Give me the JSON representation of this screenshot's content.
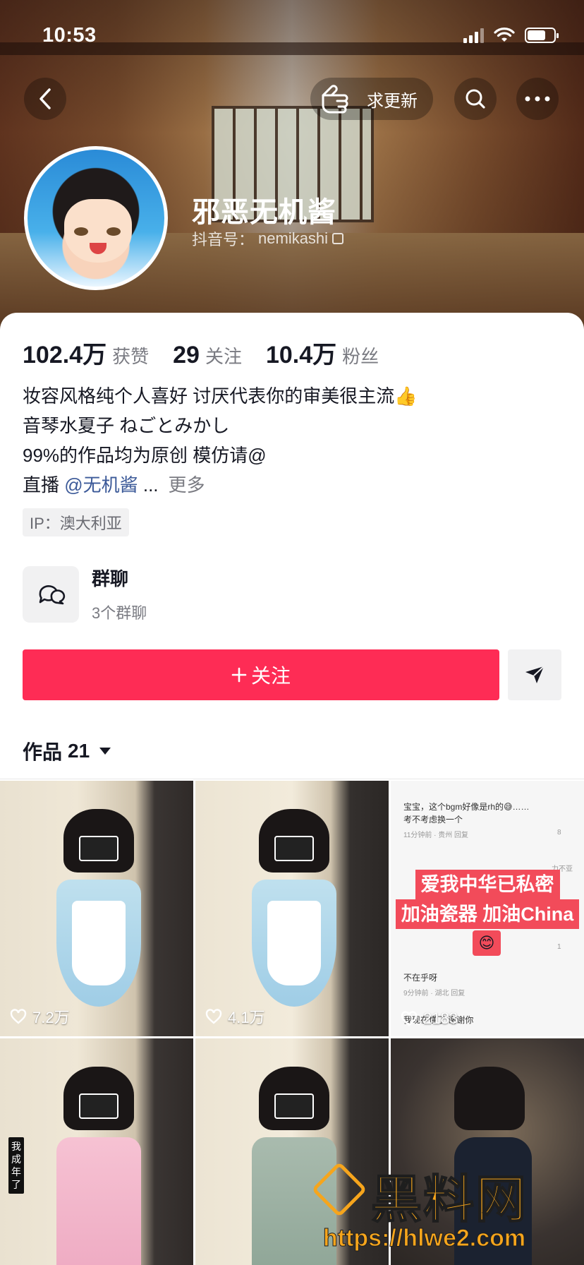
{
  "status_bar": {
    "time": "10:53"
  },
  "header": {
    "request_update": "求更新",
    "name": "邪恶无机酱",
    "uid_label": "抖音号：",
    "uid": "nemikashi"
  },
  "stats": [
    {
      "num": "102.4万",
      "label": "获赞"
    },
    {
      "num": "29",
      "label": "关注"
    },
    {
      "num": "10.4万",
      "label": "粉丝"
    }
  ],
  "bio": {
    "line1": "妆容风格纯个人喜好 讨厌代表你的审美很主流👍",
    "line2": "音琴水夏子 ねごとみかし",
    "line3": "99%的作品均为原创 模仿请@",
    "line4_prefix": "直播 ",
    "line4_mention": "@无机酱",
    "line4_ellipsis": " ...",
    "more": "更多"
  },
  "ip": "IP：澳大利亚",
  "group": {
    "title": "群聊",
    "subtitle": "3个群聊"
  },
  "actions": {
    "follow_label": "关注"
  },
  "works": {
    "label": "作品",
    "count": "21"
  },
  "videos": [
    {
      "likes": "7.2万"
    },
    {
      "likes": "4.1万"
    },
    {
      "likes": "2183"
    },
    {
      "tag": "我成年了"
    },
    {},
    {}
  ],
  "comments_cell": {
    "c1": "宝宝，这个bgm好像是rh的😅……",
    "c1b": "考不考虑换一个",
    "c1meta": "11分钟前 · 贵州  回复",
    "c1likes": "8",
    "c2": "力不亚",
    "banner1": "爱我中华已私密",
    "banner2": "加油瓷器 加油China",
    "emoji": "😊",
    "c3likes": "1",
    "c4": "不在乎呀",
    "c4meta": "9分钟前 · 湖北  回复",
    "c5": "我现在懂了 谢谢你"
  },
  "watermark": {
    "title": "黑料网",
    "url": "https://hlwe2.com"
  }
}
